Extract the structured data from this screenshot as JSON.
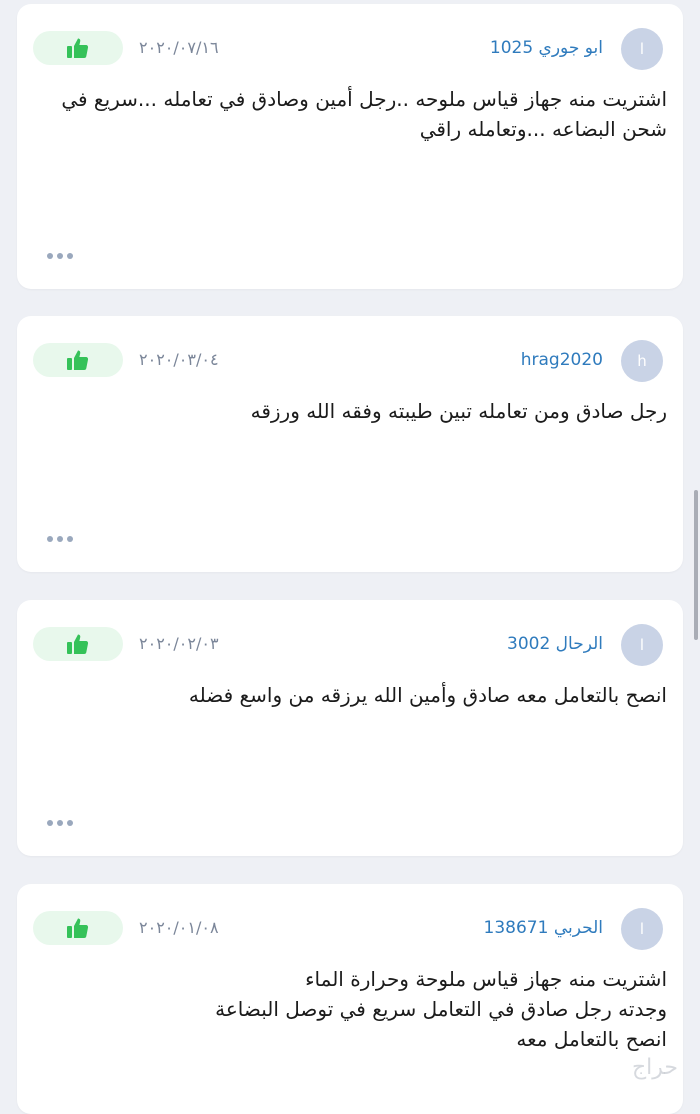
{
  "reviews": [
    {
      "avatar_letter": "ا",
      "username": "ابو جوري 1025",
      "date": "٢٠٢٠/٠٧/١٦",
      "lines": [
        "اشتريت منه جهاز قياس ملوحه ..رجل أمين وصادق في تعامله ...سريع في",
        "شحن البضاعه ...وتعامله راقي"
      ]
    },
    {
      "avatar_letter": "h",
      "username": "hrag2020",
      "date": "٢٠٢٠/٠٣/٠٤",
      "lines": [
        "رجل صادق ومن تعامله تبين طيبته وفقه الله ورزقه"
      ]
    },
    {
      "avatar_letter": "ا",
      "username": "الرحال 3002",
      "date": "٢٠٢٠/٠٢/٠٣",
      "lines": [
        "انصح بالتعامل معه صادق وأمين الله يرزقه من واسع فضله"
      ]
    },
    {
      "avatar_letter": "ا",
      "username": "الحربي 138671",
      "date": "٢٠٢٠/٠١/٠٨",
      "lines": [
        "اشتريت منه جهاز قياس ملوحة وحرارة الماء",
        "وجدته رجل صادق في التعامل سريع في توصل البضاعة",
        "انصح بالتعامل معه"
      ]
    }
  ],
  "icons": {
    "like": "thumbs-up-icon",
    "more": "more-dots-icon"
  },
  "colors": {
    "like_green": "#35c259",
    "username_blue": "#2f7bbd",
    "avatar_bg": "#c9d3e6"
  },
  "watermark": "حراج"
}
